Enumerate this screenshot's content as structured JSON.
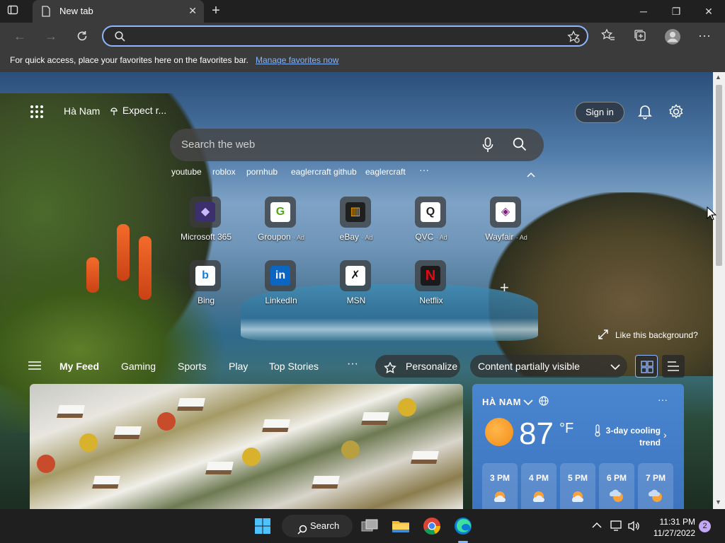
{
  "browser": {
    "tab_title": "New tab",
    "address_value": "",
    "favorites_message": "For quick access, place your favorites here on the favorites bar.",
    "favorites_link": "Manage favorites now"
  },
  "newtab": {
    "location": "Hà Nam",
    "weather_mini": "Expect r...",
    "sign_in": "Sign in",
    "search_placeholder": "Search the web",
    "trending": [
      "youtube",
      "roblox",
      "pornhub",
      "eaglercraft github",
      "eaglercraft"
    ],
    "more": "···",
    "tiles_row1": [
      {
        "label": "Microsoft 365",
        "ad": "",
        "glyph": "◆",
        "color": "#7a5cf0"
      },
      {
        "label": "Groupon",
        "ad": "· Ad",
        "glyph": "G",
        "color": "#53a318"
      },
      {
        "label": "eBay",
        "ad": "· Ad",
        "glyph": "▥",
        "color": "#e53238"
      },
      {
        "label": "QVC",
        "ad": "· Ad",
        "glyph": "Q",
        "color": "#ffffff"
      },
      {
        "label": "Wayfair",
        "ad": "· Ad",
        "glyph": "◈",
        "color": "#7f187f"
      }
    ],
    "tiles_row2": [
      {
        "label": "Bing",
        "ad": "",
        "glyph": "b",
        "color": "#ffffff"
      },
      {
        "label": "LinkedIn",
        "ad": "",
        "glyph": "in",
        "color": "#0a66c2"
      },
      {
        "label": "MSN",
        "ad": "",
        "glyph": "✗",
        "color": "#ffffff"
      },
      {
        "label": "Netflix",
        "ad": "",
        "glyph": "N",
        "color": "#e50914"
      }
    ],
    "add_tile": "+",
    "like_background": "Like this background?"
  },
  "feed": {
    "tabs": [
      "My Feed",
      "Gaming",
      "Sports",
      "Play",
      "Top Stories"
    ],
    "more": "···",
    "personalize": "Personalize",
    "content_visibility": "Content partially visible"
  },
  "weather": {
    "location": "HÀ NAM",
    "temp": "87",
    "unit": "°F",
    "trend": "3-day cooling trend",
    "more": "···",
    "hours": [
      "3 PM",
      "4 PM",
      "5 PM",
      "6 PM",
      "7 PM"
    ]
  },
  "taskbar": {
    "search": "Search",
    "time": "11:31 PM",
    "date": "11/27/2022",
    "notifications": "2"
  }
}
